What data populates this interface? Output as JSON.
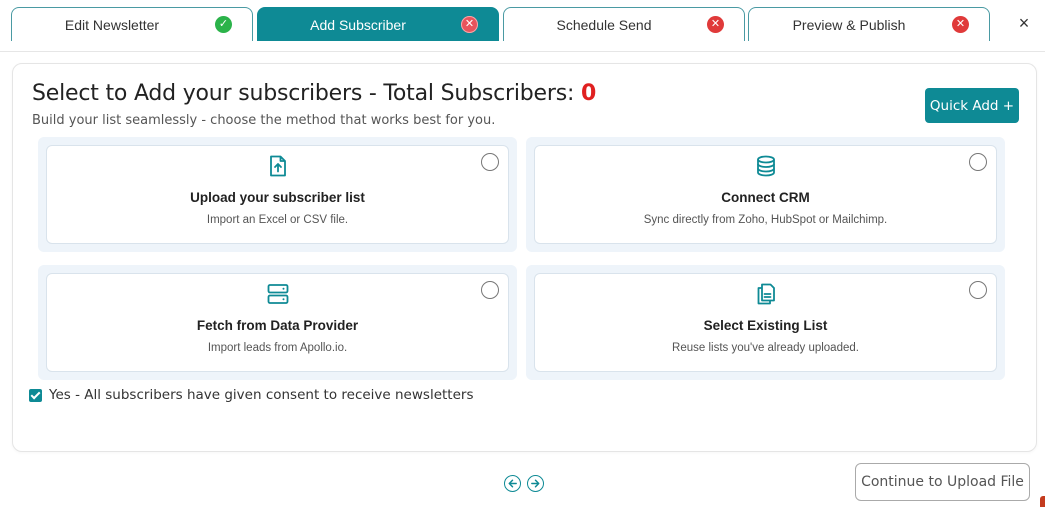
{
  "tabs": [
    {
      "label": "Edit Newsletter",
      "status": "complete",
      "status_icon": "check-icon"
    },
    {
      "label": "Add Subscriber",
      "status": "error",
      "status_icon": "x-icon"
    },
    {
      "label": "Schedule Send",
      "status": "error",
      "status_icon": "x-icon"
    },
    {
      "label": "Preview & Publish",
      "status": "error",
      "status_icon": "x-icon"
    }
  ],
  "close_glyph": "×",
  "header": {
    "title": "Select to Add your subscribers - Total Subscribers: ",
    "count": "0",
    "subtitle": "Build your list seamlessly - choose the method that works best for you."
  },
  "quick_add_label": "Quick Add +",
  "options": [
    {
      "title": "Upload your subscriber list",
      "desc": "Import an Excel or CSV file.",
      "icon": "file-upload-icon",
      "selected": false
    },
    {
      "title": "Connect CRM",
      "desc": "Sync directly from Zoho, HubSpot or Mailchimp.",
      "icon": "database-icon",
      "selected": false
    },
    {
      "title": "Fetch from Data Provider",
      "desc": "Import leads from Apollo.io.",
      "icon": "server-icon",
      "selected": false
    },
    {
      "title": "Select Existing List",
      "desc": "Reuse lists you've already uploaded.",
      "icon": "document-list-icon",
      "selected": false
    }
  ],
  "consent": {
    "label": "Yes - All subscribers have given consent to receive newsletters",
    "checked": true
  },
  "continue_label": "Continue to Upload File",
  "colors": {
    "accent": "#0e8a95",
    "success": "#2bb34a",
    "error": "#e03a3a",
    "count": "#e02020"
  }
}
